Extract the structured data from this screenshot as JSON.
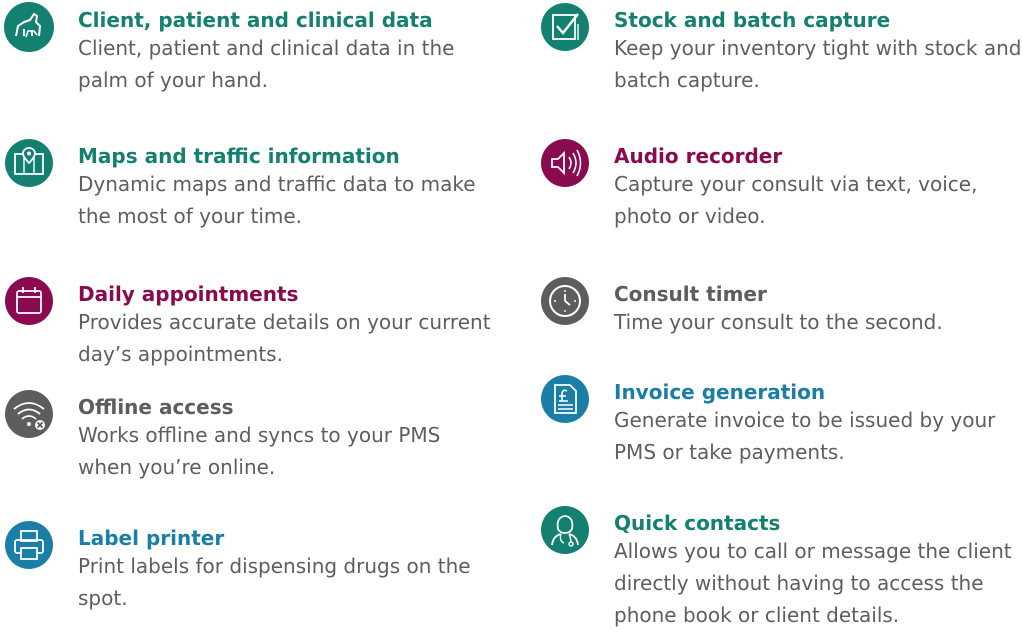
{
  "colors": {
    "teal": "#138070",
    "purple": "#8a0a50",
    "grey": "#5d5d5d",
    "blue": "#1b7ea6",
    "body_text": "#5e5e5e"
  },
  "left": [
    {
      "icon": "horse-dog-icon",
      "title": "Client, patient and clinical data",
      "description": "Client, patient and clinical data in the palm of your hand."
    },
    {
      "icon": "map-pin-icon",
      "title": "Maps and traffic information",
      "description": "Dynamic maps and traffic data to make the most of your time."
    },
    {
      "icon": "calendar-icon",
      "title": "Daily appointments",
      "description": "Provides accurate details on your current day’s appointments."
    },
    {
      "icon": "wifi-off-icon",
      "title": "Offline access",
      "description": "Works offline and syncs to your PMS when you’re online."
    },
    {
      "icon": "printer-icon",
      "title": "Label printer",
      "description": "Print labels for dispensing drugs on the spot."
    }
  ],
  "right": [
    {
      "icon": "checklist-icon",
      "title": "Stock and batch capture",
      "description": "Keep your inventory tight with stock and batch capture."
    },
    {
      "icon": "speaker-icon",
      "title": "Audio recorder",
      "description": "Capture your consult via text, voice, photo or video."
    },
    {
      "icon": "clock-icon",
      "title": "Consult timer",
      "description": "Time your consult to the second."
    },
    {
      "icon": "invoice-pound-icon",
      "title": "Invoice generation",
      "description": "Generate invoice to be issued by your PMS or take payments."
    },
    {
      "icon": "vet-contact-icon",
      "title": "Quick contacts",
      "description": "Allows you to call or message the client directly without having to access the phone book or client details."
    }
  ]
}
